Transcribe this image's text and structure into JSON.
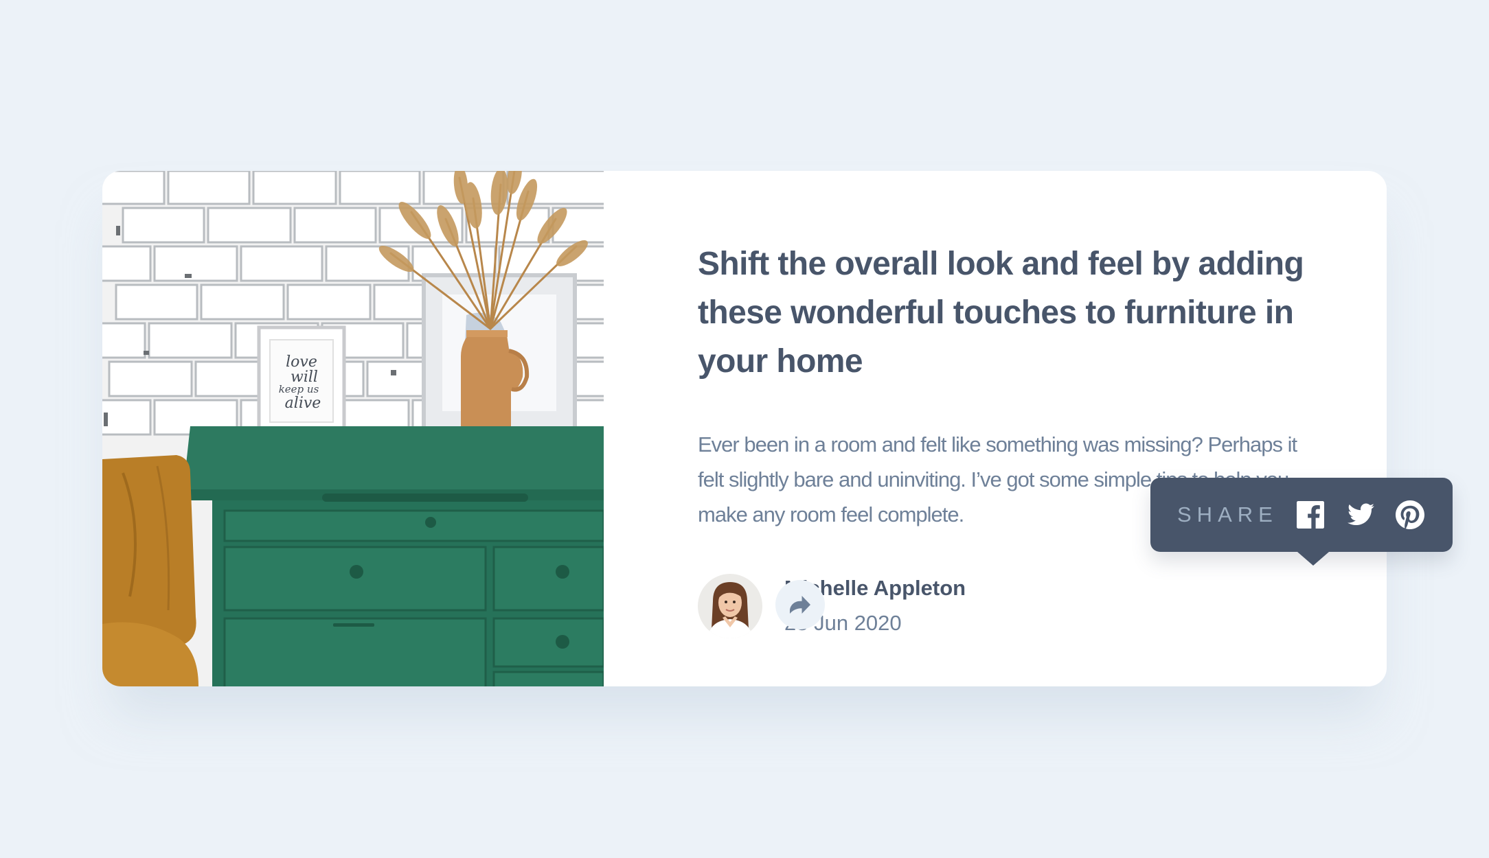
{
  "article": {
    "headline": "Shift the overall look and feel by adding these wonderful touches to furniture in your home",
    "excerpt": "Ever been in a room and felt like something was missing? Perhaps it felt slightly bare and uninviting. I’ve got some simple tips to help you make any room feel complete.",
    "image_frame_text": "love will keep us alive"
  },
  "author": {
    "name": "Michelle Appleton",
    "date": "28 Jun 2020"
  },
  "share": {
    "label": "SHARE",
    "networks": [
      "facebook-icon",
      "twitter-icon",
      "pinterest-icon"
    ],
    "button_icon": "share-arrow-icon"
  },
  "colors": {
    "background": "#ecf2f8",
    "card": "#ffffff",
    "heading": "#48556a",
    "body_text": "#6e8098",
    "tooltip": "#48556a",
    "tooltip_label": "#9eafc2"
  }
}
